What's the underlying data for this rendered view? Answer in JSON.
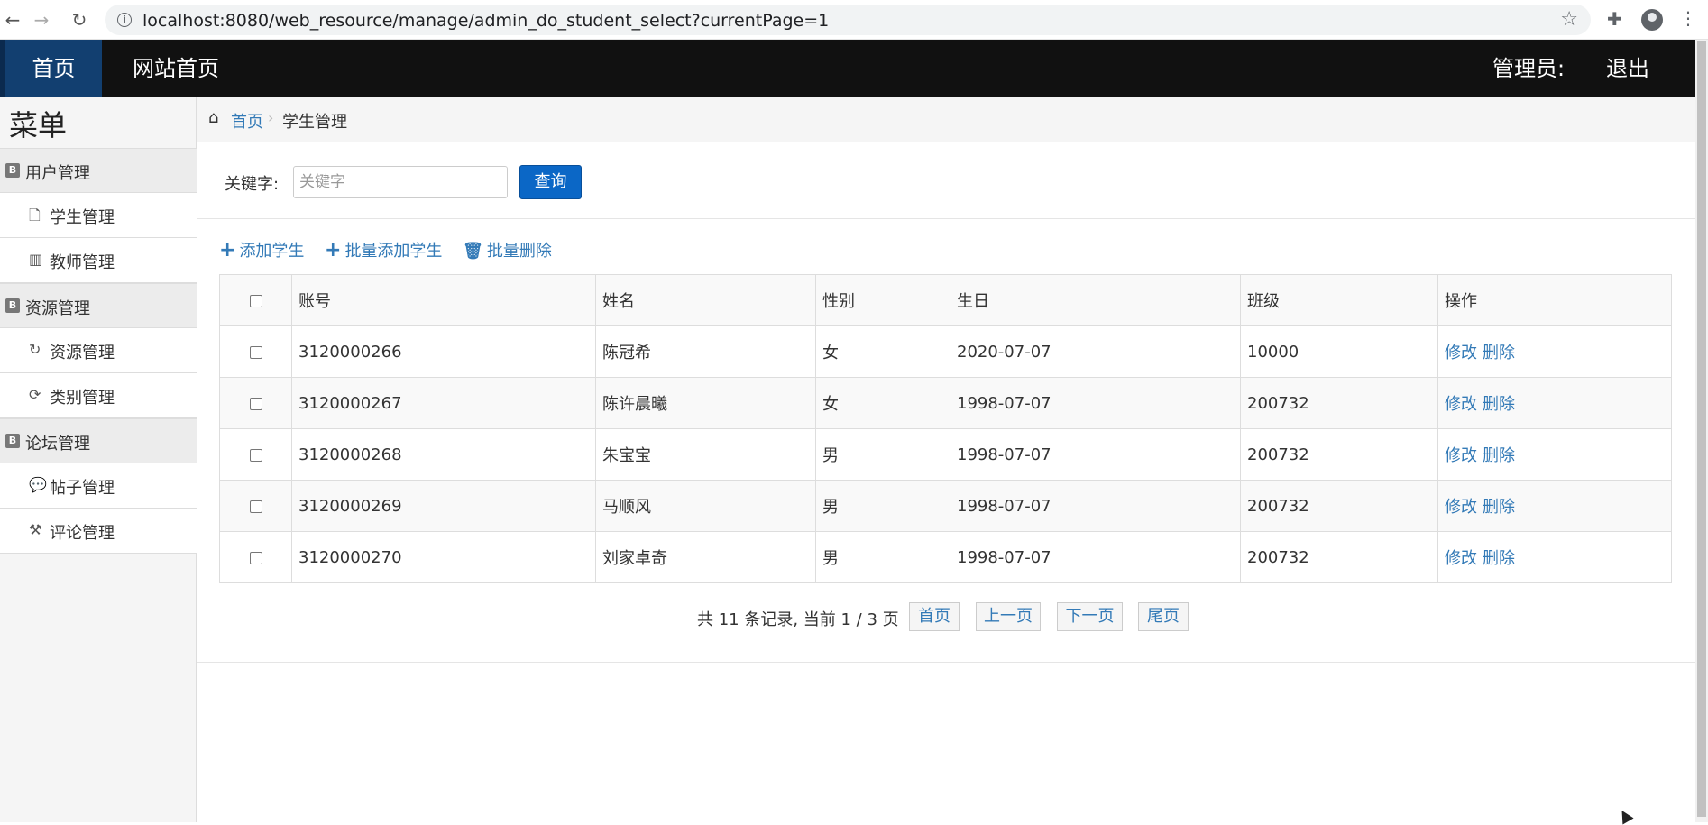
{
  "browser": {
    "url": "localhost:8080/web_resource/manage/admin_do_student_select?currentPage=1",
    "back_icon": "arrow-left-icon",
    "forward_icon": "arrow-right-icon",
    "reload_icon": "reload-icon"
  },
  "topnav": {
    "home": "首页",
    "site_home": "网站首页",
    "admin": "管理员:",
    "logout": "退出"
  },
  "sidebar": {
    "title": "菜单",
    "groups": [
      {
        "label": "用户管理",
        "items": [
          {
            "label": "学生管理",
            "icon": "file-icon"
          },
          {
            "label": "教师管理",
            "icon": "books-icon"
          }
        ]
      },
      {
        "label": "资源管理",
        "items": [
          {
            "label": "资源管理",
            "icon": "refresh-icon"
          },
          {
            "label": "类别管理",
            "icon": "sync-icon"
          }
        ]
      },
      {
        "label": "论坛管理",
        "items": [
          {
            "label": "帖子管理",
            "icon": "comment-icon"
          },
          {
            "label": "评论管理",
            "icon": "gavel-icon"
          }
        ]
      }
    ]
  },
  "breadcrumb": {
    "home": "首页",
    "current": "学生管理"
  },
  "search": {
    "label": "关键字:",
    "placeholder": "关键字",
    "value": "",
    "button": "查询"
  },
  "toolbar": {
    "add": "添加学生",
    "batch_add": "批量添加学生",
    "batch_delete": "批量删除"
  },
  "table": {
    "headers": [
      "账号",
      "姓名",
      "性别",
      "生日",
      "班级",
      "操作"
    ],
    "rows": [
      {
        "account": "3120000266",
        "name": "陈冠希",
        "gender": "女",
        "birthday": "2020-07-07",
        "class": "10000",
        "edit": "修改",
        "delete": "删除"
      },
      {
        "account": "3120000267",
        "name": "陈许晨曦",
        "gender": "女",
        "birthday": "1998-07-07",
        "class": "200732",
        "edit": "修改",
        "delete": "删除"
      },
      {
        "account": "3120000268",
        "name": "朱宝宝",
        "gender": "男",
        "birthday": "1998-07-07",
        "class": "200732",
        "edit": "修改",
        "delete": "删除"
      },
      {
        "account": "3120000269",
        "name": "马顺风",
        "gender": "男",
        "birthday": "1998-07-07",
        "class": "200732",
        "edit": "修改",
        "delete": "删除"
      },
      {
        "account": "3120000270",
        "name": "刘家卓奇",
        "gender": "男",
        "birthday": "1998-07-07",
        "class": "200732",
        "edit": "修改",
        "delete": "删除"
      }
    ]
  },
  "pager": {
    "info": "共 11 条记录,  当前 1 / 3 页",
    "first": "首页",
    "prev": "上一页",
    "next": "下一页",
    "last": "尾页"
  }
}
